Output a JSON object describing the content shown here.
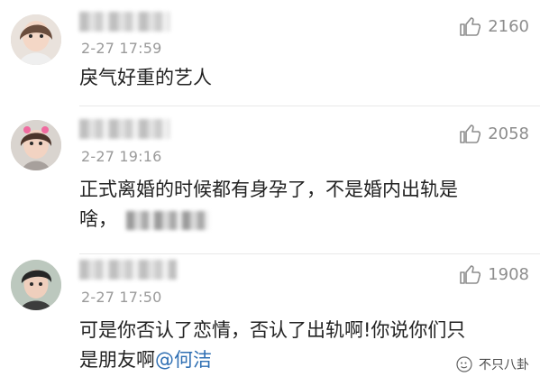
{
  "comments": [
    {
      "time": "2-27 17:59",
      "likes": "2160",
      "text_lines": [
        "戾气好重的艺人"
      ]
    },
    {
      "time": "2-27 19:16",
      "likes": "2058",
      "text_lines": [
        "正式离婚的时候都有身孕了，不是婚内出轨是",
        "啥，"
      ]
    },
    {
      "time": "2-27 17:50",
      "likes": "1908",
      "text_lines": [
        "可是你否认了恋情，否认了出轨啊!你说你们只",
        "是朋友啊"
      ],
      "mention": "@何洁"
    }
  ],
  "watermark": {
    "text": "不只八卦"
  },
  "colors": {
    "timestamp": "#9a9a9a",
    "mention": "#2f6fb3",
    "divider": "#e8e8e8"
  },
  "icons": [
    "thumb-up-icon",
    "watermark-icon"
  ]
}
